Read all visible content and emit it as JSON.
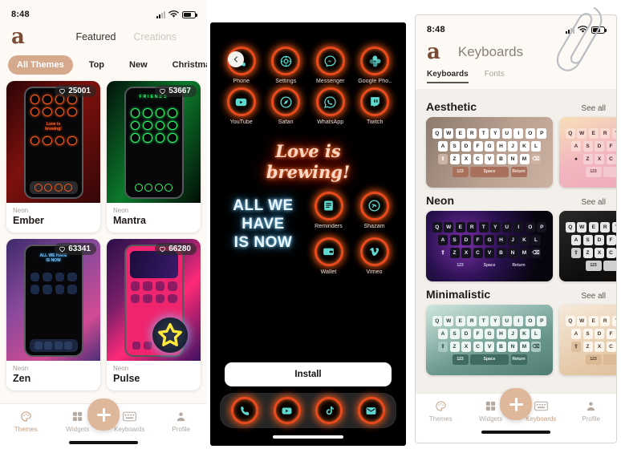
{
  "left_panel": {
    "status": {
      "time": "8:48",
      "signal_icon": "signal-icon",
      "wifi_icon": "wifi-icon",
      "battery_icon": "battery-icon"
    },
    "logo": "a",
    "top_tabs": [
      {
        "label": "Featured",
        "active": true
      },
      {
        "label": "Creations",
        "active": false
      }
    ],
    "chips": [
      {
        "label": "All Themes",
        "active": true
      },
      {
        "label": "Top",
        "active": false
      },
      {
        "label": "New",
        "active": false
      },
      {
        "label": "Christmas",
        "active": false
      }
    ],
    "cards": [
      {
        "likes": "25001",
        "category": "Neon",
        "name": "Ember",
        "accent": "#ff5a19",
        "bg1": "#3a0a0a",
        "bg2": "#8c1410"
      },
      {
        "likes": "53667",
        "category": "Neon",
        "name": "Mantra",
        "accent": "#2bff6a",
        "bg1": "#02200c",
        "bg2": "#0b8a2e"
      },
      {
        "likes": "63341",
        "category": "Neon",
        "name": "Zen",
        "accent": "#4fb4ff",
        "bg1": "#3a2a63",
        "bg2": "#c84fa0"
      },
      {
        "likes": "66280",
        "category": "Neon",
        "name": "Pulse",
        "accent": "#ff3bb0",
        "bg1": "#2a0f4a",
        "bg2": "#ff2a78"
      }
    ],
    "card_quote": "ALL WE HAVE IS NOW",
    "star_badge_icon": "star-icon",
    "tabbar": [
      {
        "label": "Themes",
        "icon": "palette-icon",
        "active": true
      },
      {
        "label": "Widgets",
        "icon": "widgets-icon",
        "active": false
      },
      {
        "label": "Keyboards",
        "icon": "keyboard-icon",
        "active": false
      },
      {
        "label": "Profile",
        "icon": "profile-icon",
        "active": false
      }
    ],
    "fab_icon": "plus-icon"
  },
  "center_panel": {
    "back_icon": "chevron-left-icon",
    "apps_top": [
      {
        "label": "Phone",
        "icon": "phone-icon"
      },
      {
        "label": "Settings",
        "icon": "settings-icon"
      },
      {
        "label": "Messenger",
        "icon": "messenger-icon"
      },
      {
        "label": "Google Pho..",
        "icon": "google-photos-icon"
      },
      {
        "label": "YouTube",
        "icon": "youtube-icon"
      },
      {
        "label": "Safari",
        "icon": "safari-icon"
      },
      {
        "label": "WhatsApp",
        "icon": "whatsapp-icon"
      },
      {
        "label": "Twitch",
        "icon": "twitch-icon"
      }
    ],
    "neon_quote_line1": "Love is",
    "neon_quote_line2": "brewing!",
    "blue_quote": "ALL WE\nHAVE\nIS NOW",
    "apps_right": [
      {
        "label": "Reminders",
        "icon": "reminders-icon"
      },
      {
        "label": "Shazam",
        "icon": "shazam-icon"
      },
      {
        "label": "Wallet",
        "icon": "wallet-icon"
      },
      {
        "label": "Vimeo",
        "icon": "vimeo-icon"
      }
    ],
    "install_label": "Install",
    "dock": [
      {
        "label": "Phone",
        "icon": "phone-icon"
      },
      {
        "label": "YouTube",
        "icon": "youtube-icon"
      },
      {
        "label": "TikTok",
        "icon": "tiktok-icon"
      },
      {
        "label": "Mail",
        "icon": "mail-icon"
      }
    ],
    "accent_color": "#ff5a19",
    "icon_color": "#5fd8d0"
  },
  "right_panel": {
    "status": {
      "time": "8:48",
      "signal_icon": "signal-icon",
      "wifi_icon": "wifi-icon",
      "battery_icon": "battery-icon"
    },
    "logo": "a",
    "title": "Keyboards",
    "segments": [
      {
        "label": "Keyboards",
        "active": true
      },
      {
        "label": "Fonts",
        "active": false
      }
    ],
    "see_all_label": "See all",
    "sections": [
      {
        "title": "Aesthetic",
        "cards": [
          {
            "key_bg": "#ffffff",
            "key_fg": "#2a2420",
            "board_bg": "#b08a78",
            "fn_bg": "#a9705c",
            "fn_fg": "#f5e7e0"
          },
          {
            "key_bg": "#f6c9cf",
            "key_fg": "#4a2830",
            "board_bg": "#f2b6bf",
            "fn_bg": "#eea7b3",
            "fn_fg": "#6d3442"
          }
        ]
      },
      {
        "title": "Neon",
        "cards": [
          {
            "key_bg": "#15131c",
            "key_fg": "#e9e4f5",
            "board_bg": "#0d0a14",
            "fn_bg": "#1a1622",
            "fn_fg": "#cfc8e0"
          },
          {
            "key_bg": "#e8e8e8",
            "key_fg": "#1a1a1a",
            "board_bg": "#171717",
            "fn_bg": "#cfcfcf",
            "fn_fg": "#2a2a2a"
          }
        ]
      },
      {
        "title": "Minimalistic",
        "cards": [
          {
            "key_bg": "#e8f2ee",
            "key_fg": "#23403a",
            "board_bg": "#4f7d74",
            "fn_bg": "#3f6b62",
            "fn_fg": "#e6f1ee"
          },
          {
            "key_bg": "#fbf1e6",
            "key_fg": "#4a3a2b",
            "board_bg": "#e5c9a8",
            "fn_bg": "#dcba95",
            "fn_fg": "#4a3a2b"
          }
        ]
      }
    ],
    "keyboard_rows": {
      "row1": [
        "Q",
        "W",
        "E",
        "R",
        "T",
        "Y",
        "U",
        "I",
        "O",
        "P"
      ],
      "row2": [
        "A",
        "S",
        "D",
        "F",
        "G",
        "H",
        "J",
        "K",
        "L"
      ],
      "row3": [
        "Z",
        "X",
        "C",
        "V",
        "B",
        "N",
        "M"
      ],
      "numeric_key": "123",
      "space_key": "Space",
      "return_key": "Return",
      "shift_icon": "shift-icon",
      "backspace_icon": "backspace-icon"
    },
    "tabbar": [
      {
        "label": "Themes",
        "icon": "palette-icon",
        "active": false
      },
      {
        "label": "Widgets",
        "icon": "widgets-icon",
        "active": false
      },
      {
        "label": "Keyboards",
        "icon": "keyboard-icon",
        "active": true
      },
      {
        "label": "Profile",
        "icon": "profile-icon",
        "active": false
      }
    ],
    "fab_icon": "plus-icon"
  },
  "overlay": {
    "paperclip_icon": "paperclip-icon"
  }
}
